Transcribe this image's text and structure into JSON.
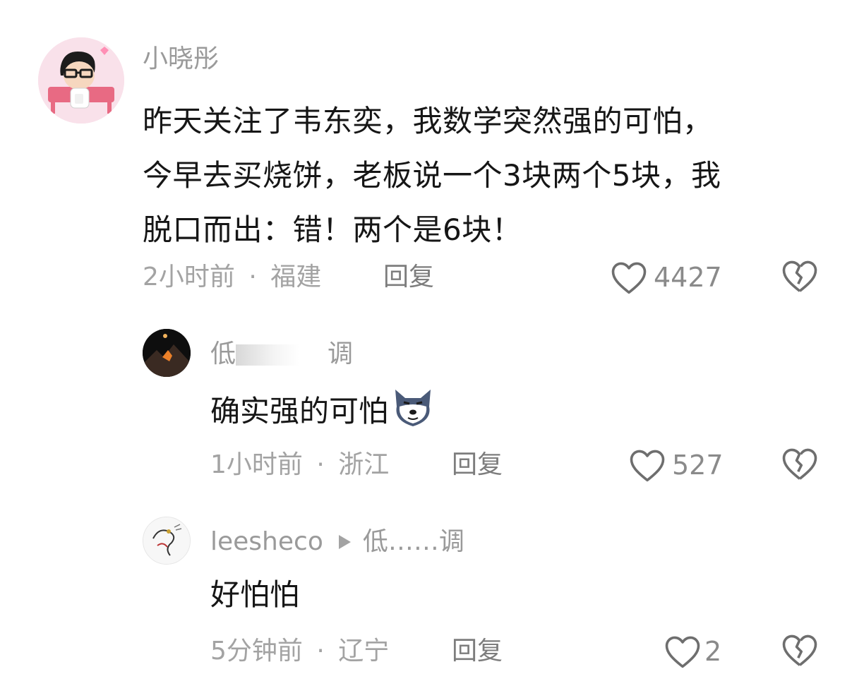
{
  "comments": [
    {
      "username": "小晓彤",
      "lines": [
        "昨天关注了韦东奕，我数学突然强的可怕，",
        "今早去买烧饼，老板说一个3块两个5块，我",
        "脱口而出：错！两个是6块！"
      ],
      "time": "2小时前",
      "location": "福建",
      "reply_label": "回复",
      "likes": "4427",
      "avatar": "cartoon-glasses-avatar"
    },
    {
      "username_start": "低",
      "username_end": "调",
      "text": "确实强的可怕",
      "emoji": "dog-emoji",
      "time": "1小时前",
      "location": "浙江",
      "reply_label": "回复",
      "likes": "527",
      "avatar": "dark-landscape-avatar"
    },
    {
      "username": "leesheco",
      "reply_to": "低……调",
      "text": "好怕怕",
      "time": "5分钟前",
      "location": "辽宁",
      "reply_label": "回复",
      "likes": "2",
      "avatar": "dragon-drawing-avatar"
    }
  ],
  "separator": "·",
  "colors": {
    "text": "#161616",
    "muted": "#a3a3a3",
    "icon": "#6e6e6e"
  }
}
